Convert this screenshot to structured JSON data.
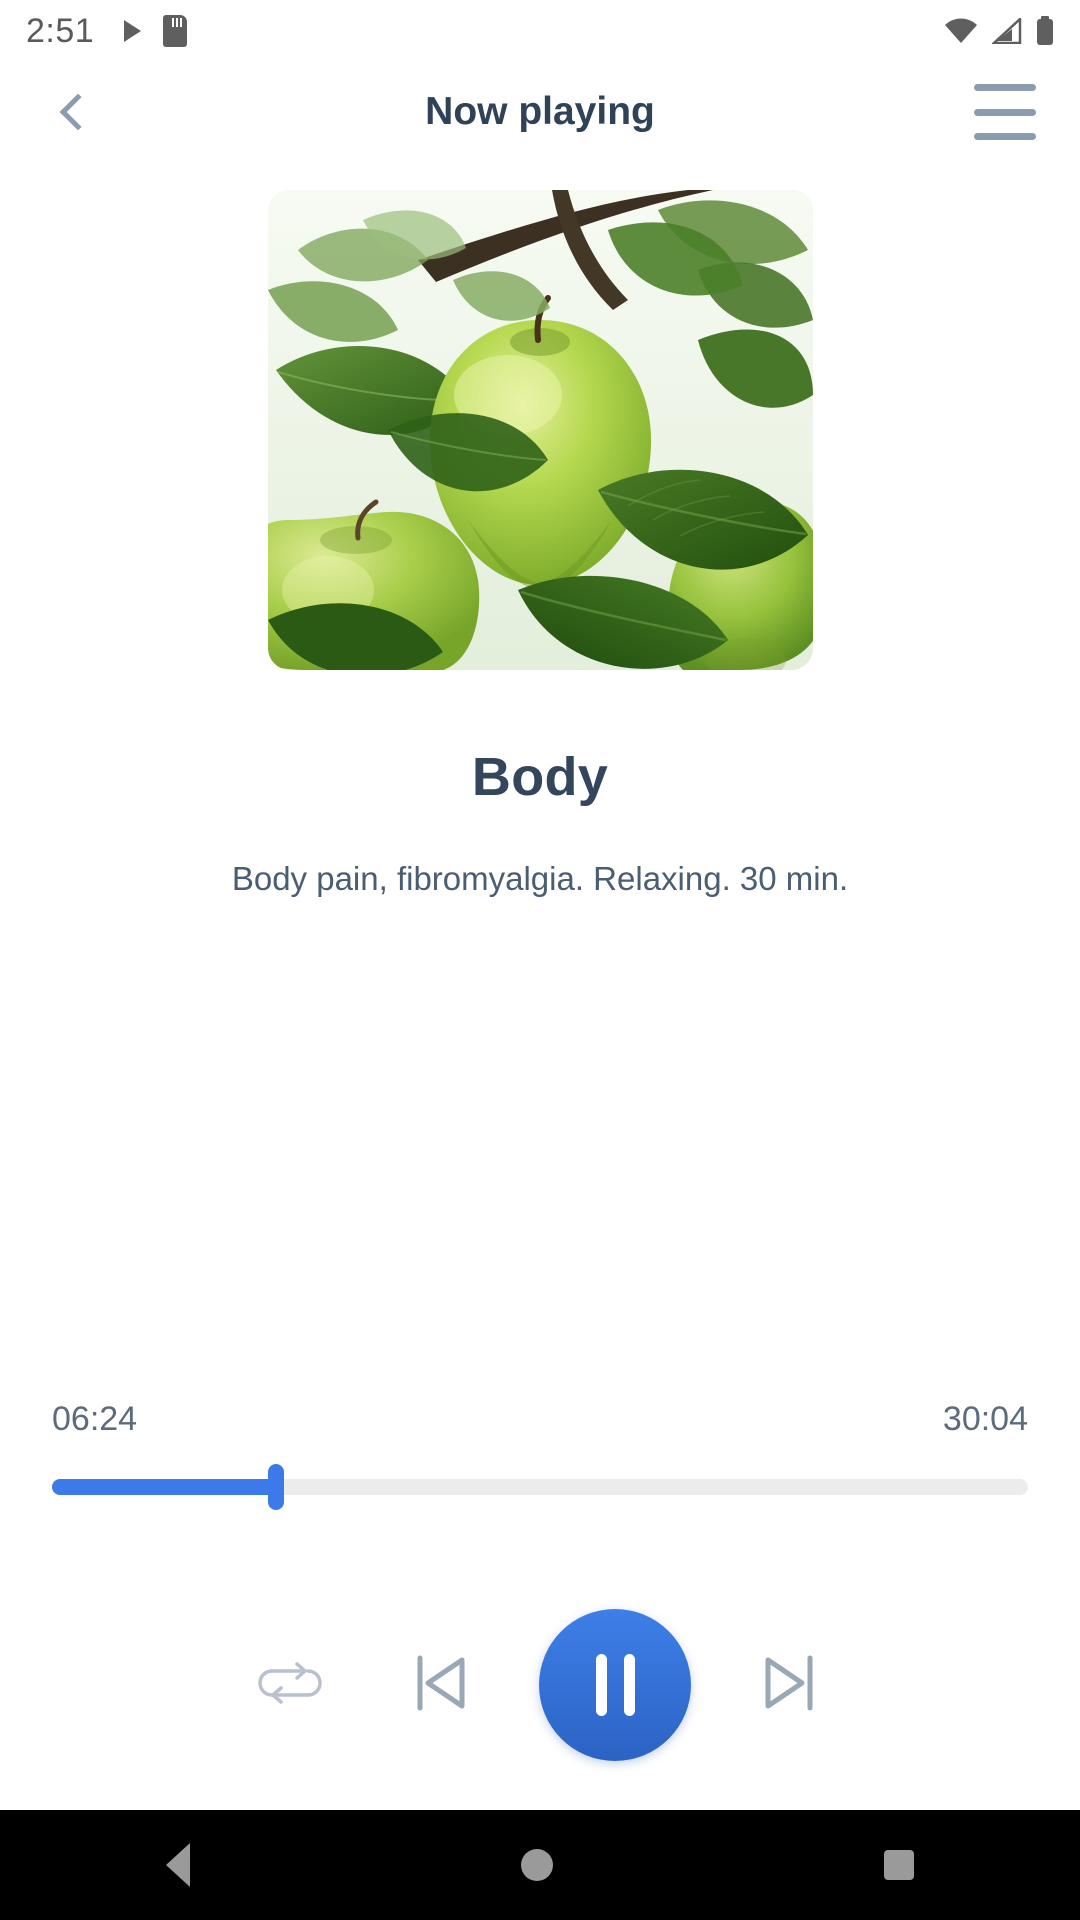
{
  "status_bar": {
    "time": "2:51",
    "icons": [
      "play-icon",
      "sd-card-icon",
      "wifi-icon",
      "cellular-signal-icon",
      "battery-icon"
    ]
  },
  "header": {
    "title": "Now playing",
    "back_icon": "chevron-left-icon",
    "menu_icon": "hamburger-menu-icon"
  },
  "artwork": {
    "alt": "green apples on tree branch",
    "icon": "album-artwork"
  },
  "track": {
    "title": "Body",
    "description": "Body pain, fibromyalgia. Relaxing. 30 min."
  },
  "player": {
    "elapsed": "06:24",
    "duration": "30:04",
    "progress_percent": 23,
    "accent_color": "#3b7ae8",
    "repeat_icon": "repeat-icon",
    "previous_icon": "skip-previous-icon",
    "play_pause_icon": "pause-icon",
    "next_icon": "skip-next-icon"
  },
  "navigation_bar": {
    "back_icon": "nav-back-icon",
    "home_icon": "nav-home-icon",
    "recents_icon": "nav-recents-icon"
  }
}
